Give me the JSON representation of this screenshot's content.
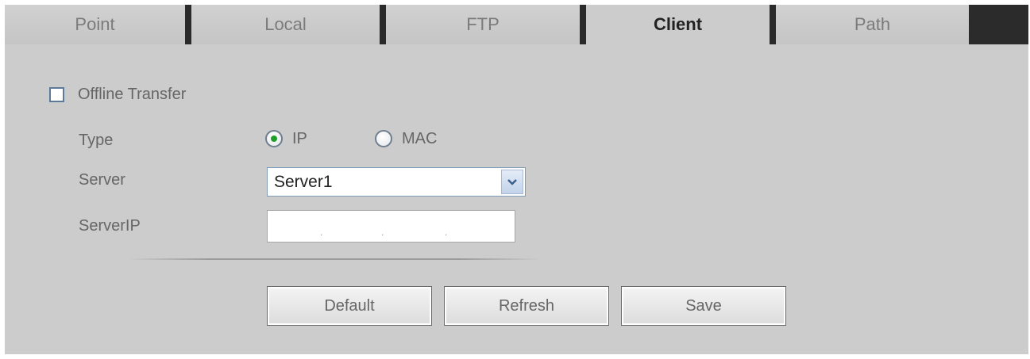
{
  "tabs": [
    {
      "label": "Point",
      "active": false
    },
    {
      "label": "Local",
      "active": false
    },
    {
      "label": "FTP",
      "active": false
    },
    {
      "label": "Client",
      "active": true
    },
    {
      "label": "Path",
      "active": false
    }
  ],
  "offline_transfer": {
    "label": "Offline Transfer",
    "checked": false
  },
  "type": {
    "label": "Type",
    "options": [
      {
        "label": "IP",
        "selected": true
      },
      {
        "label": "MAC",
        "selected": false
      }
    ]
  },
  "server": {
    "label": "Server",
    "value": "Server1"
  },
  "server_ip": {
    "label": "ServerIP",
    "value": ""
  },
  "buttons": {
    "default": "Default",
    "refresh": "Refresh",
    "save": "Save"
  },
  "colors": {
    "panel_bg": "#cccccc",
    "tab_separator": "#2a2a2a",
    "radio_selected": "#1f9e2a",
    "checkbox_border": "#5d7a99"
  }
}
